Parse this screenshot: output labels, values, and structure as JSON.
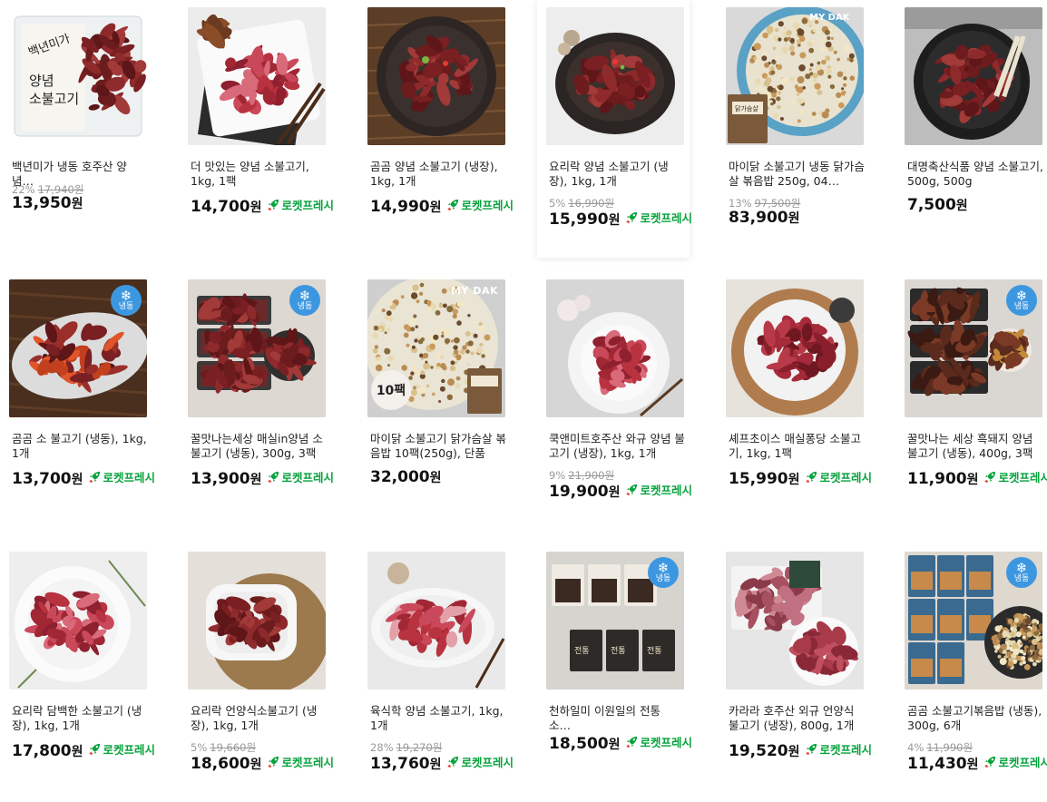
{
  "colors": {
    "rocket": "#07a33d",
    "frozen_badge": "#3d97e0",
    "price": "#111111",
    "discount": "#999999"
  },
  "rocket_label": "로켓프레시",
  "frozen_label": "냉동",
  "products": [
    {
      "name": "백년미가 냉동 호주산 양념…",
      "discount": "22%",
      "original": "17,940원",
      "price": "13,950",
      "won": "원",
      "rocket": false,
      "frozen": false,
      "img": "package-red"
    },
    {
      "name": "더 맛있는 양념 소불고기, 1kg, 1팩",
      "discount": "",
      "original": "",
      "price": "14,700",
      "won": "원",
      "rocket": true,
      "frozen": false,
      "img": "white-plate"
    },
    {
      "name": "곰곰 양념 소불고기 (냉장), 1kg, 1개",
      "discount": "",
      "original": "",
      "price": "14,990",
      "won": "원",
      "rocket": true,
      "frozen": false,
      "img": "dark-plate-wood"
    },
    {
      "name": "요리락 양념 소불고기 (냉장), 1kg, 1개",
      "discount": "5%",
      "original": "16,990원",
      "price": "15,990",
      "won": "원",
      "rocket": true,
      "frozen": false,
      "img": "dark-plate-white"
    },
    {
      "name": "마이닭 소불고기 냉동 닭가슴살 볶음밥 250g, 04…",
      "discount": "13%",
      "original": "97,500원",
      "price": "83,900",
      "won": "원",
      "rocket": false,
      "frozen": false,
      "img": "fried-rice-blue"
    },
    {
      "name": "대명축산식품 양념 소불고기, 500g, 500g",
      "discount": "",
      "original": "",
      "price": "7,500",
      "won": "원",
      "rocket": false,
      "frozen": false,
      "img": "black-bowl"
    },
    {
      "name": "곰곰 소 불고기 (냉동), 1kg, 1개",
      "discount": "",
      "original": "",
      "price": "13,700",
      "won": "원",
      "rocket": true,
      "frozen": true,
      "img": "long-plate-wood"
    },
    {
      "name": "꿀맛나는세상 매실in양념 소불고기 (냉동), 300g, 3팩",
      "discount": "",
      "original": "",
      "price": "13,900",
      "won": "원",
      "rocket": true,
      "frozen": true,
      "img": "packs-three"
    },
    {
      "name": "마이닭 소불고기 닭가슴살 볶음밥 10팩(250g), 단품",
      "discount": "",
      "original": "",
      "price": "32,000",
      "won": "원",
      "rocket": false,
      "frozen": false,
      "img": "fried-rice-10",
      "tag": "10팩",
      "brand": "MY DAK"
    },
    {
      "name": "쿡앤미트호주산 와규 양념 불고기 (냉장), 1kg, 1개",
      "discount": "9%",
      "original": "21,900원",
      "price": "19,900",
      "won": "원",
      "rocket": true,
      "frozen": false,
      "img": "white-bowl-garlic"
    },
    {
      "name": "셰프초이스 매실퐁당 소불고기, 1kg, 1팩",
      "discount": "",
      "original": "",
      "price": "15,990",
      "won": "원",
      "rocket": true,
      "frozen": false,
      "img": "wood-board"
    },
    {
      "name": "꿀맛나는 세상 흑돼지 양념 불고기 (냉동), 400g, 3팩",
      "discount": "",
      "original": "",
      "price": "11,900",
      "won": "원",
      "rocket": true,
      "frozen": true,
      "img": "packs-dark"
    },
    {
      "name": "요리락 담백한 소불고기 (냉장), 1kg, 1개",
      "discount": "",
      "original": "",
      "price": "17,800",
      "won": "원",
      "rocket": true,
      "frozen": false,
      "img": "white-plate-herb"
    },
    {
      "name": "요리락 언양식소불고기 (냉장), 1kg, 1개",
      "discount": "5%",
      "original": "19,660원",
      "price": "18,600",
      "won": "원",
      "rocket": true,
      "frozen": false,
      "img": "white-dish-basket"
    },
    {
      "name": "육식학 양념 소불고기, 1kg, 1개",
      "discount": "28%",
      "original": "19,270원",
      "price": "13,760",
      "won": "원",
      "rocket": true,
      "frozen": false,
      "img": "oval-plate"
    },
    {
      "name": "천하일미 이원일의 전통 소…",
      "discount": "",
      "original": "",
      "price": "18,500",
      "won": "원",
      "rocket": true,
      "frozen": true,
      "img": "pouches"
    },
    {
      "name": "카라라 호주산 외규 언양식 불고기 (냉장), 800g, 1개",
      "discount": "",
      "original": "",
      "price": "19,520",
      "won": "원",
      "rocket": true,
      "frozen": false,
      "img": "minced-tray"
    },
    {
      "name": "곰곰 소불고기볶음밥 (냉동), 300g, 6개",
      "discount": "4%",
      "original": "11,990원",
      "price": "11,430",
      "won": "원",
      "rocket": true,
      "frozen": true,
      "img": "rice-packs"
    }
  ]
}
